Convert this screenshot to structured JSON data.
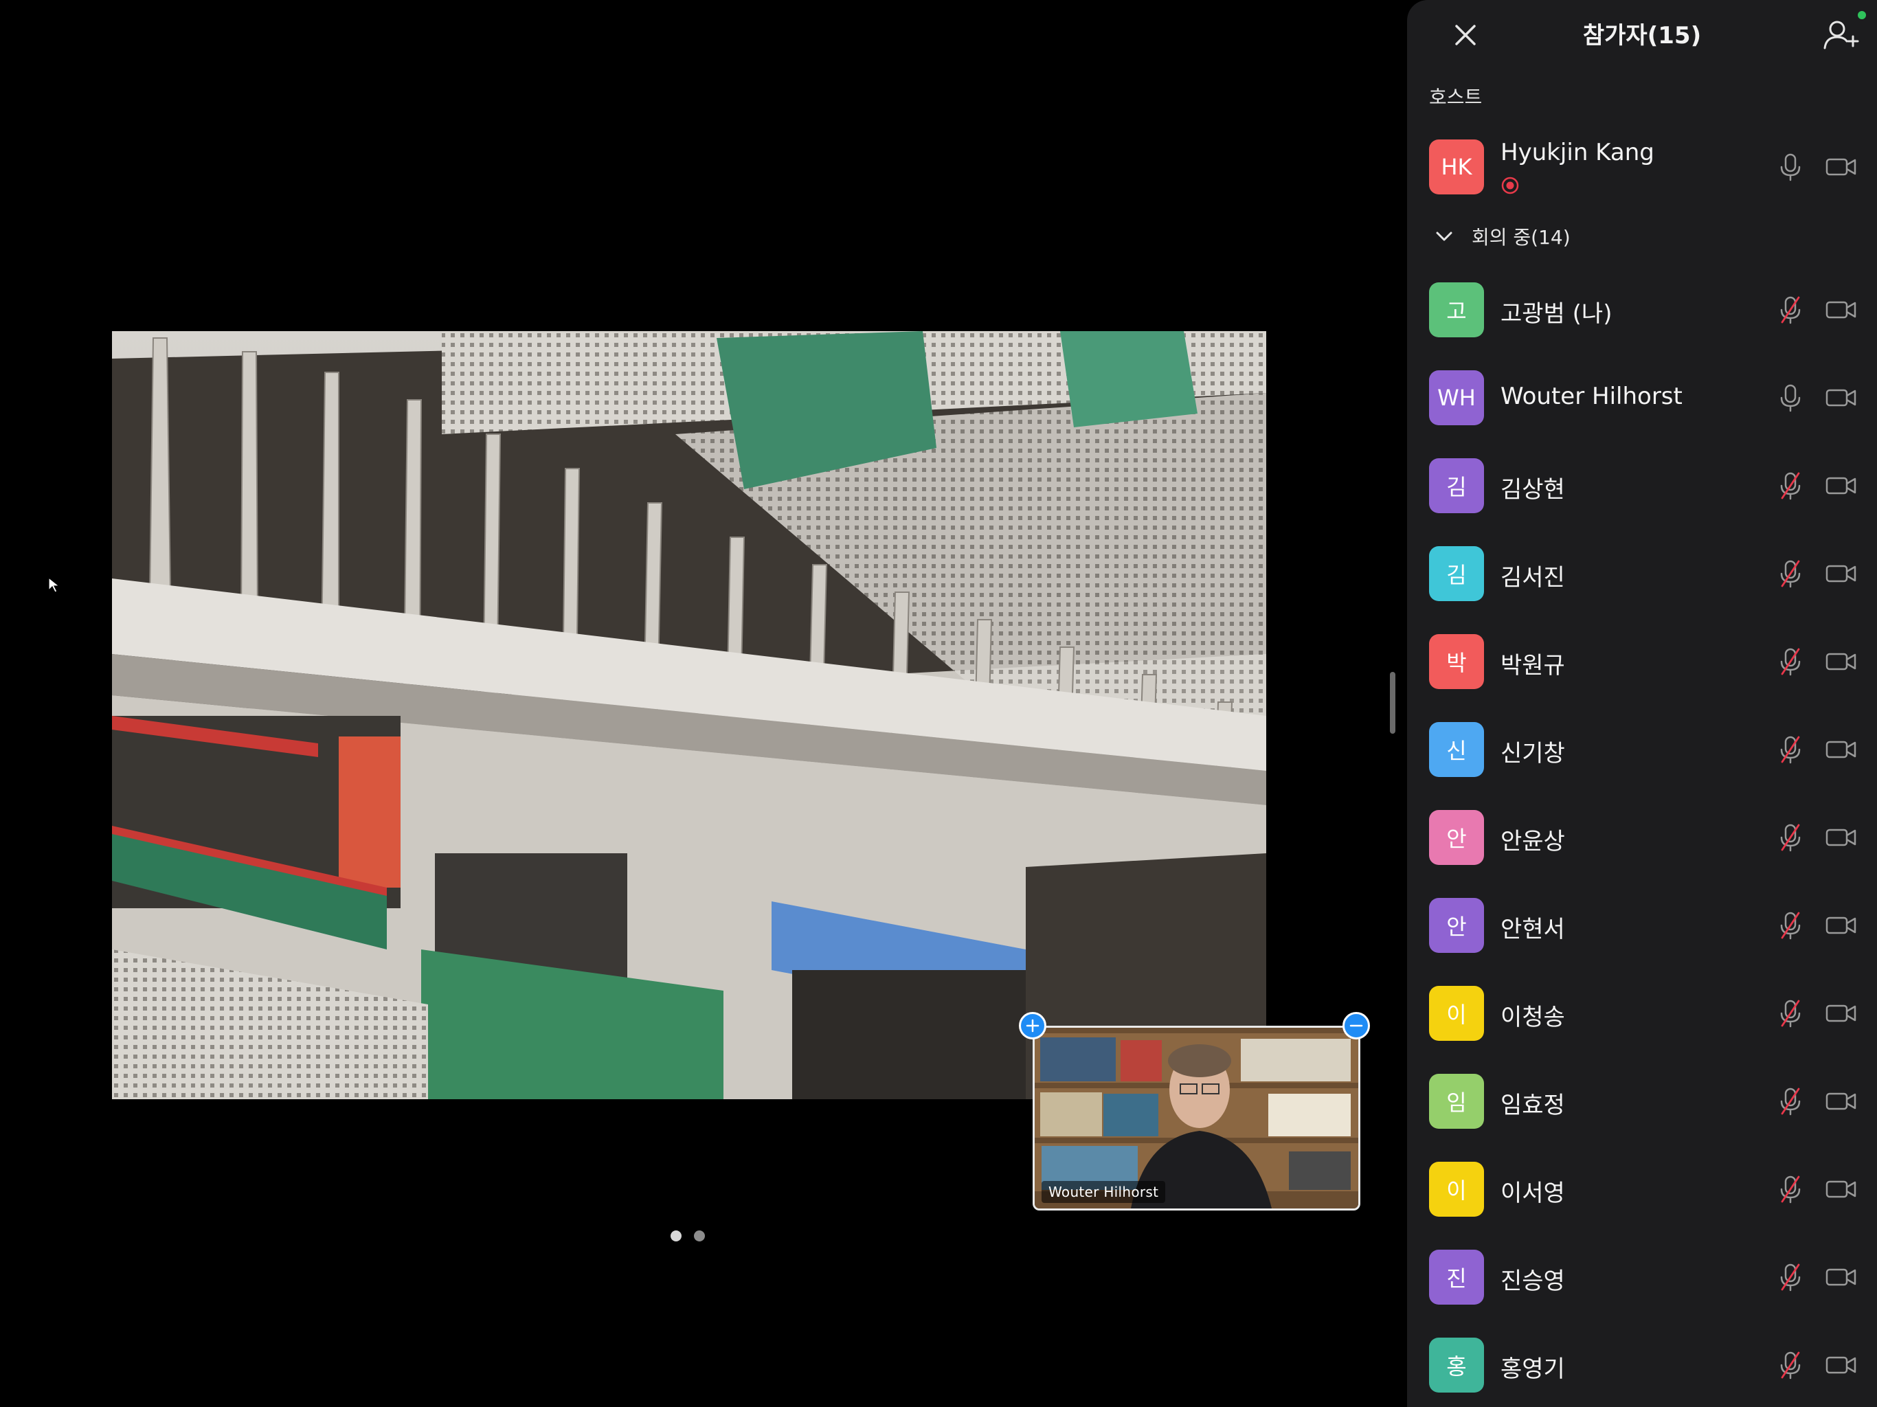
{
  "video": {
    "thumb_name": "Wouter Hilhorst",
    "pages": 2,
    "active_page": 1
  },
  "panel": {
    "title": "참가자(15)",
    "host_section": "호스트",
    "group_section": "회의 중(14)"
  },
  "host": {
    "initials": "HK",
    "name": "Hyukjin Kang",
    "color": "#f25b5b",
    "recording": true,
    "muted": false
  },
  "participants": [
    {
      "initials": "고",
      "name": "고광범 (나)",
      "color": "#5cc17a",
      "muted": true
    },
    {
      "initials": "WH",
      "name": "Wouter Hilhorst",
      "color": "#8f63d2",
      "muted": false
    },
    {
      "initials": "김",
      "name": "김상현",
      "color": "#8f63d2",
      "muted": true
    },
    {
      "initials": "김",
      "name": "김서진",
      "color": "#3fc6d8",
      "muted": true
    },
    {
      "initials": "박",
      "name": "박원규",
      "color": "#f25b5b",
      "muted": true
    },
    {
      "initials": "신",
      "name": "신기창",
      "color": "#4ea8f2",
      "muted": true
    },
    {
      "initials": "안",
      "name": "안윤상",
      "color": "#e879b0",
      "muted": true
    },
    {
      "initials": "안",
      "name": "안현서",
      "color": "#8f63d2",
      "muted": true
    },
    {
      "initials": "이",
      "name": "이청송",
      "color": "#f5d20f",
      "muted": true
    },
    {
      "initials": "임",
      "name": "임효정",
      "color": "#95cf6b",
      "muted": true
    },
    {
      "initials": "이",
      "name": "이서영",
      "color": "#f5d20f",
      "muted": true
    },
    {
      "initials": "진",
      "name": "진승영",
      "color": "#8f63d2",
      "muted": true
    },
    {
      "initials": "홍",
      "name": "홍영기",
      "color": "#3fb59a",
      "muted": true
    }
  ],
  "icons": {
    "close": "close-icon",
    "invite": "add-person-icon",
    "collapse": "chevron-down-icon",
    "mic": "microphone-icon",
    "mic_muted": "microphone-muted-icon",
    "camera": "video-camera-icon",
    "recording": "recording-icon"
  }
}
